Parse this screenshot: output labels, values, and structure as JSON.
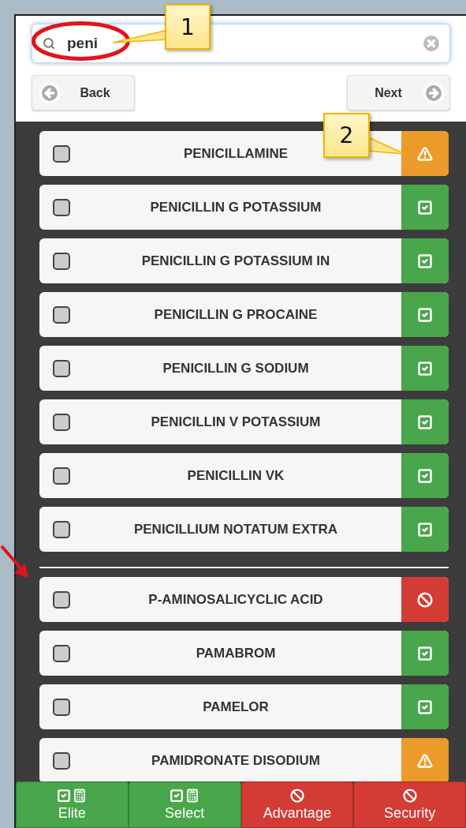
{
  "search": {
    "value": "peni"
  },
  "nav": {
    "back": "Back",
    "next": "Next"
  },
  "groups": [
    {
      "items": [
        {
          "name": "PENICILLAMINE",
          "checked": false,
          "kind": "warning"
        },
        {
          "name": "PENICILLIN G POTASSIUM",
          "checked": false,
          "kind": "ok"
        },
        {
          "name": "PENICILLIN G POTASSIUM IN",
          "checked": false,
          "kind": "ok"
        },
        {
          "name": "PENICILLIN G PROCAINE",
          "checked": false,
          "kind": "ok"
        },
        {
          "name": "PENICILLIN G SODIUM",
          "checked": false,
          "kind": "ok"
        },
        {
          "name": "PENICILLIN V POTASSIUM",
          "checked": false,
          "kind": "ok"
        },
        {
          "name": "PENICILLIN VK",
          "checked": false,
          "kind": "ok"
        },
        {
          "name": "PENICILLIUM NOTATUM EXTRA",
          "checked": false,
          "kind": "ok"
        }
      ]
    },
    {
      "items": [
        {
          "name": "P-AMINOSALICYCLIC ACID",
          "checked": false,
          "kind": "blocked"
        },
        {
          "name": "PAMABROM",
          "checked": false,
          "kind": "ok"
        },
        {
          "name": "PAMELOR",
          "checked": false,
          "kind": "ok"
        },
        {
          "name": "PAMIDRONATE DISODIUM",
          "checked": false,
          "kind": "warning"
        }
      ]
    }
  ],
  "plans": [
    {
      "label": "Elite",
      "kind": "ok"
    },
    {
      "label": "Select",
      "kind": "ok"
    },
    {
      "label": "Advantage",
      "kind": "blocked"
    },
    {
      "label": "Security",
      "kind": "blocked"
    }
  ],
  "callouts": [
    {
      "label": "1"
    },
    {
      "label": "2"
    }
  ]
}
